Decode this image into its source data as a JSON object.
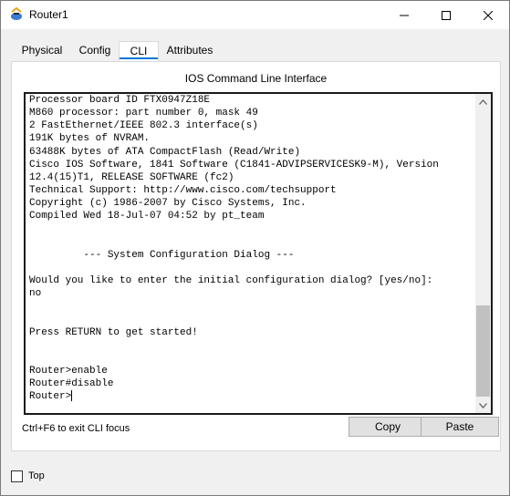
{
  "window": {
    "title": "Router1"
  },
  "tabs": [
    {
      "label": "Physical",
      "active": false
    },
    {
      "label": "Config",
      "active": false
    },
    {
      "label": "CLI",
      "active": true
    },
    {
      "label": "Attributes",
      "active": false
    }
  ],
  "cli": {
    "heading": "IOS Command Line Interface",
    "lines": [
      "Processor board ID FTX0947Z18E",
      "M860 processor: part number 0, mask 49",
      "2 FastEthernet/IEEE 802.3 interface(s)",
      "191K bytes of NVRAM.",
      "63488K bytes of ATA CompactFlash (Read/Write)",
      "Cisco IOS Software, 1841 Software (C1841-ADVIPSERVICESK9-M), Version",
      "12.4(15)T1, RELEASE SOFTWARE (fc2)",
      "Technical Support: http://www.cisco.com/techsupport",
      "Copyright (c) 1986-2007 by Cisco Systems, Inc.",
      "Compiled Wed 18-Jul-07 04:52 by pt_team",
      "",
      "",
      "         --- System Configuration Dialog ---",
      "",
      "Would you like to enter the initial configuration dialog? [yes/no]:",
      "no",
      "",
      "",
      "Press RETURN to get started!",
      "",
      "",
      "Router>enable",
      "Router#disable",
      "Router>"
    ],
    "hint": "Ctrl+F6 to exit CLI focus",
    "copy_label": "Copy",
    "paste_label": "Paste"
  },
  "footer": {
    "top_label": "Top",
    "top_checked": false
  },
  "colors": {
    "accent": "#0078d7"
  }
}
